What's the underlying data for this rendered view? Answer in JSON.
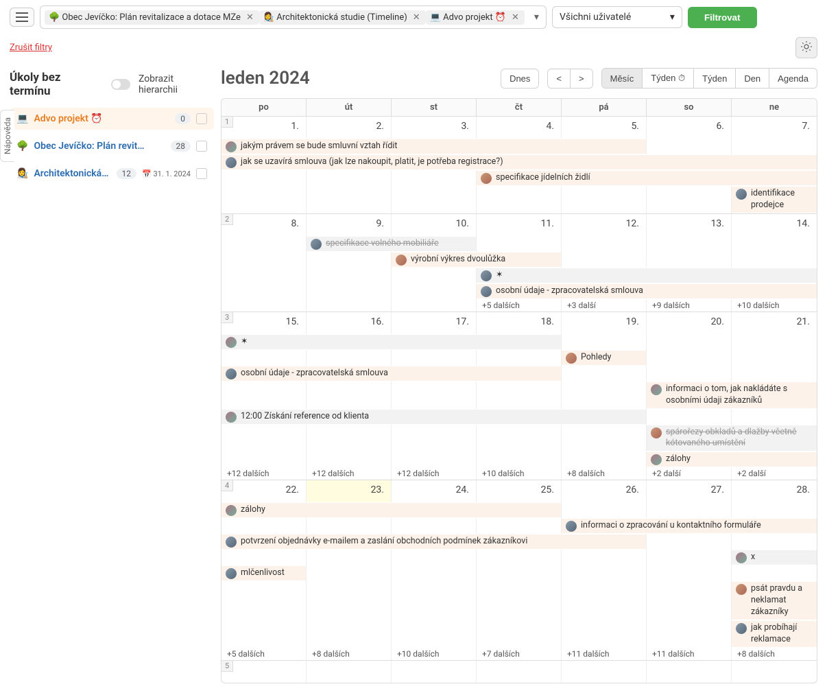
{
  "topbar": {
    "tags": [
      {
        "emoji": "🌳",
        "label": "Obec Jevíčko: Plán revitalizace a dotace MZe"
      },
      {
        "emoji": "👩‍🎨",
        "label": "Architektonická studie (Timeline)"
      },
      {
        "emoji": "💻",
        "label": "Advo projekt ⏰"
      }
    ],
    "userFilter": "Všichni uživatelé",
    "filterBtn": "Filtrovat"
  },
  "cancelFilters": "Zrušit filtry",
  "sidebar": {
    "title": "Úkoly bez termínu",
    "hierarchy": "Zobrazit hierarchii",
    "projects": [
      {
        "emoji": "💻",
        "name": "Advo projekt ⏰",
        "count": "0",
        "active": true
      },
      {
        "emoji": "🌳",
        "name": "Obec Jevíčko: Plán revit…",
        "count": "28",
        "blue": true
      },
      {
        "emoji": "👩‍🎨",
        "name": "Architektonická…",
        "count": "12",
        "date": "31. 1. 2024",
        "blue": true
      }
    ]
  },
  "helpTab": "Nápověda",
  "calendar": {
    "title": "leden 2024",
    "todayBtn": "Dnes",
    "prev": "<",
    "next": ">",
    "views": [
      "Měsíc",
      "Týden ⏱",
      "Týden",
      "Den",
      "Agenda"
    ],
    "activeView": 0,
    "dayHeaders": [
      "po",
      "út",
      "st",
      "čt",
      "pá",
      "so",
      "ne"
    ],
    "weeks": [
      {
        "num": "1",
        "days": [
          "1.",
          "2.",
          "3.",
          "4.",
          "5.",
          "6.",
          "7."
        ],
        "spanEvents": [
          {
            "s": 1,
            "l": 5,
            "text": "jakým právem se bude smluvní vztah řídit",
            "av": "av"
          },
          {
            "s": 1,
            "l": 7,
            "text": "jak se uzavírá smlouva (jak lze nakoupit, platit, je potřeba registrace?)",
            "av": "av2"
          },
          {
            "s": 4,
            "l": 4,
            "text": "specifikace jídelních židlí",
            "av": "av3"
          },
          {
            "s": 7,
            "l": 1,
            "text": "identifikace prodejce",
            "av": "av2"
          }
        ],
        "more": []
      },
      {
        "num": "2",
        "days": [
          "8.",
          "9.",
          "10.",
          "11.",
          "12.",
          "13.",
          "14."
        ],
        "spanEvents": [
          {
            "s": 2,
            "l": 2,
            "text": "specifikace volného mobiliáře",
            "av": "av2",
            "striked": true,
            "grey": true
          },
          {
            "s": 3,
            "l": 2,
            "text": "výrobní výkres dvoulůžka",
            "av": "av3"
          },
          {
            "s": 4,
            "l": 4,
            "text": "✶",
            "av": "av2",
            "grey": true,
            "small": true
          },
          {
            "s": 4,
            "l": 4,
            "text": "osobní údaje - zpracovatelská smlouva",
            "av": "av2"
          }
        ],
        "more": [
          null,
          null,
          null,
          "+5 dalších",
          "+3 další",
          "+9 dalších",
          "+10 dalších"
        ]
      },
      {
        "num": "3",
        "days": [
          "15.",
          "16.",
          "17.",
          "18.",
          "19.",
          "20.",
          "21."
        ],
        "spanEvents": [
          {
            "s": 1,
            "l": 4,
            "text": "✶",
            "av": "av",
            "grey": true,
            "small": true
          },
          {
            "s": 5,
            "l": 1,
            "text": "Pohledy",
            "av": "av3"
          },
          {
            "s": 1,
            "l": 4,
            "text": "osobní údaje - zpracovatelská smlouva",
            "av": "av2"
          },
          {
            "s": 6,
            "l": 2,
            "text": "informaci o tom, jak nakládáte s osobními údaji zákazníků",
            "av": "av"
          },
          {
            "s": 1,
            "l": 5,
            "text": "12:00   Získání reference od klienta",
            "av": "av",
            "grey": true
          },
          {
            "s": 6,
            "l": 2,
            "text": "spárořezy obkladů a dlažby včetně kótovaného umístění",
            "av": "av3",
            "striked": true,
            "grey": true
          },
          {
            "s": 6,
            "l": 2,
            "text": "zálohy",
            "av": "av"
          }
        ],
        "more": [
          "+12 dalších",
          "+12 dalších",
          "+12 dalších",
          "+10 dalších",
          "+8 dalších",
          "+2 další",
          "+2 další"
        ]
      },
      {
        "num": "4",
        "days": [
          "22.",
          "23.",
          "24.",
          "25.",
          "26.",
          "27.",
          "28."
        ],
        "today": 1,
        "spanEvents": [
          {
            "s": 1,
            "l": 4,
            "text": "zálohy",
            "av": "av"
          },
          {
            "s": 5,
            "l": 3,
            "text": "informaci o zpracování u kontaktního formuláře",
            "av": "av2"
          },
          {
            "s": 1,
            "l": 5,
            "text": "potvrzení objednávky e-mailem a zaslání obchodních podmínek zákazníkovi",
            "av": "av2"
          },
          {
            "s": 7,
            "l": 1,
            "text": "x",
            "av": "av",
            "grey": true
          },
          {
            "s": 1,
            "l": 1,
            "text": "mlčenlivost",
            "av": "av2"
          },
          {
            "s": 7,
            "l": 1,
            "text": "psát pravdu a neklamat zákazníky",
            "av": "av3"
          },
          {
            "s": 7,
            "l": 1,
            "text": "jak probíhají reklamace",
            "av": "av2"
          }
        ],
        "more": [
          "+5 dalších",
          "+8 dalších",
          "+10 dalších",
          "+7 dalších",
          "+11 dalších",
          "+11 dalších",
          "+8 dalších"
        ]
      },
      {
        "num": "5",
        "days": [
          "",
          "",
          "",
          "",
          "",
          "",
          ""
        ],
        "spanEvents": [],
        "more": []
      }
    ]
  }
}
